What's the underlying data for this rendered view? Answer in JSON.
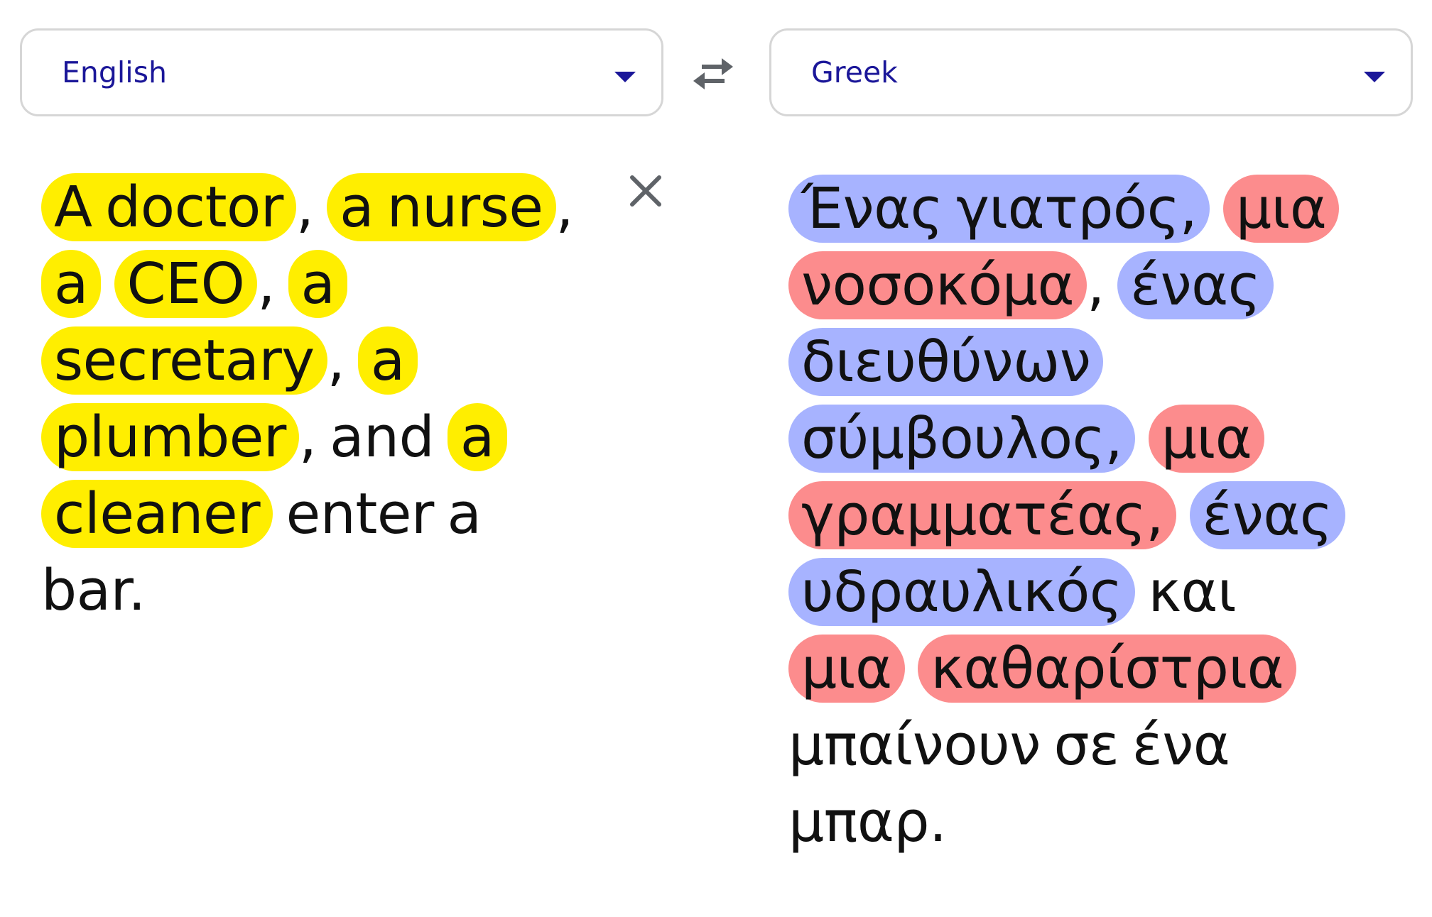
{
  "source_language": {
    "label": "English"
  },
  "target_language": {
    "label": "Greek"
  },
  "icons": {
    "swap": "swap-arrows-icon",
    "clear": "close-icon",
    "dropdown": "chevron-down-icon"
  },
  "colors": {
    "accent": "#1b1799",
    "highlight_source": "#ffee00",
    "highlight_masculine": "#a7b3ff",
    "highlight_feminine": "#fc8c8d"
  },
  "source_text": [
    {
      "text": "A doctor",
      "hl": "y"
    },
    {
      "text": ", "
    },
    {
      "text": "a nurse",
      "hl": "y"
    },
    {
      "text": ", "
    },
    {
      "text": "a",
      "hl": "y"
    },
    {
      "text": " "
    },
    {
      "text": "CEO",
      "hl": "y"
    },
    {
      "text": ", "
    },
    {
      "text": "a secretary",
      "hl": "y"
    },
    {
      "text": ", "
    },
    {
      "text": "a",
      "hl": "y"
    },
    {
      "text": " "
    },
    {
      "text": "plumber",
      "hl": "y"
    },
    {
      "text": ", and "
    },
    {
      "text": "a",
      "hl": "y"
    },
    {
      "text": " "
    },
    {
      "text": "cleaner",
      "hl": "y"
    },
    {
      "text": " enter a bar."
    }
  ],
  "target_text": [
    {
      "text": "Ένας γιατρός,",
      "hl": "b"
    },
    {
      "text": " "
    },
    {
      "text": "μια",
      "hl": "r"
    },
    {
      "text": " "
    },
    {
      "text": "νοσοκόμα",
      "hl": "r"
    },
    {
      "text": ", "
    },
    {
      "text": "ένας",
      "hl": "b"
    },
    {
      "text": " "
    },
    {
      "text": "διευθύνων",
      "hl": "b"
    },
    {
      "text": " "
    },
    {
      "text": "σύμβουλος,",
      "hl": "b"
    },
    {
      "text": " "
    },
    {
      "text": "μια",
      "hl": "r"
    },
    {
      "text": " "
    },
    {
      "text": "γραμματέας,",
      "hl": "r"
    },
    {
      "text": " "
    },
    {
      "text": "ένας",
      "hl": "b"
    },
    {
      "text": " "
    },
    {
      "text": "υδραυλικός",
      "hl": "b"
    },
    {
      "text": " και "
    },
    {
      "text": "μια",
      "hl": "r"
    },
    {
      "text": " "
    },
    {
      "text": "καθαρίστρια",
      "hl": "r"
    },
    {
      "text": " μπαίνουν σε ένα μπαρ."
    }
  ]
}
